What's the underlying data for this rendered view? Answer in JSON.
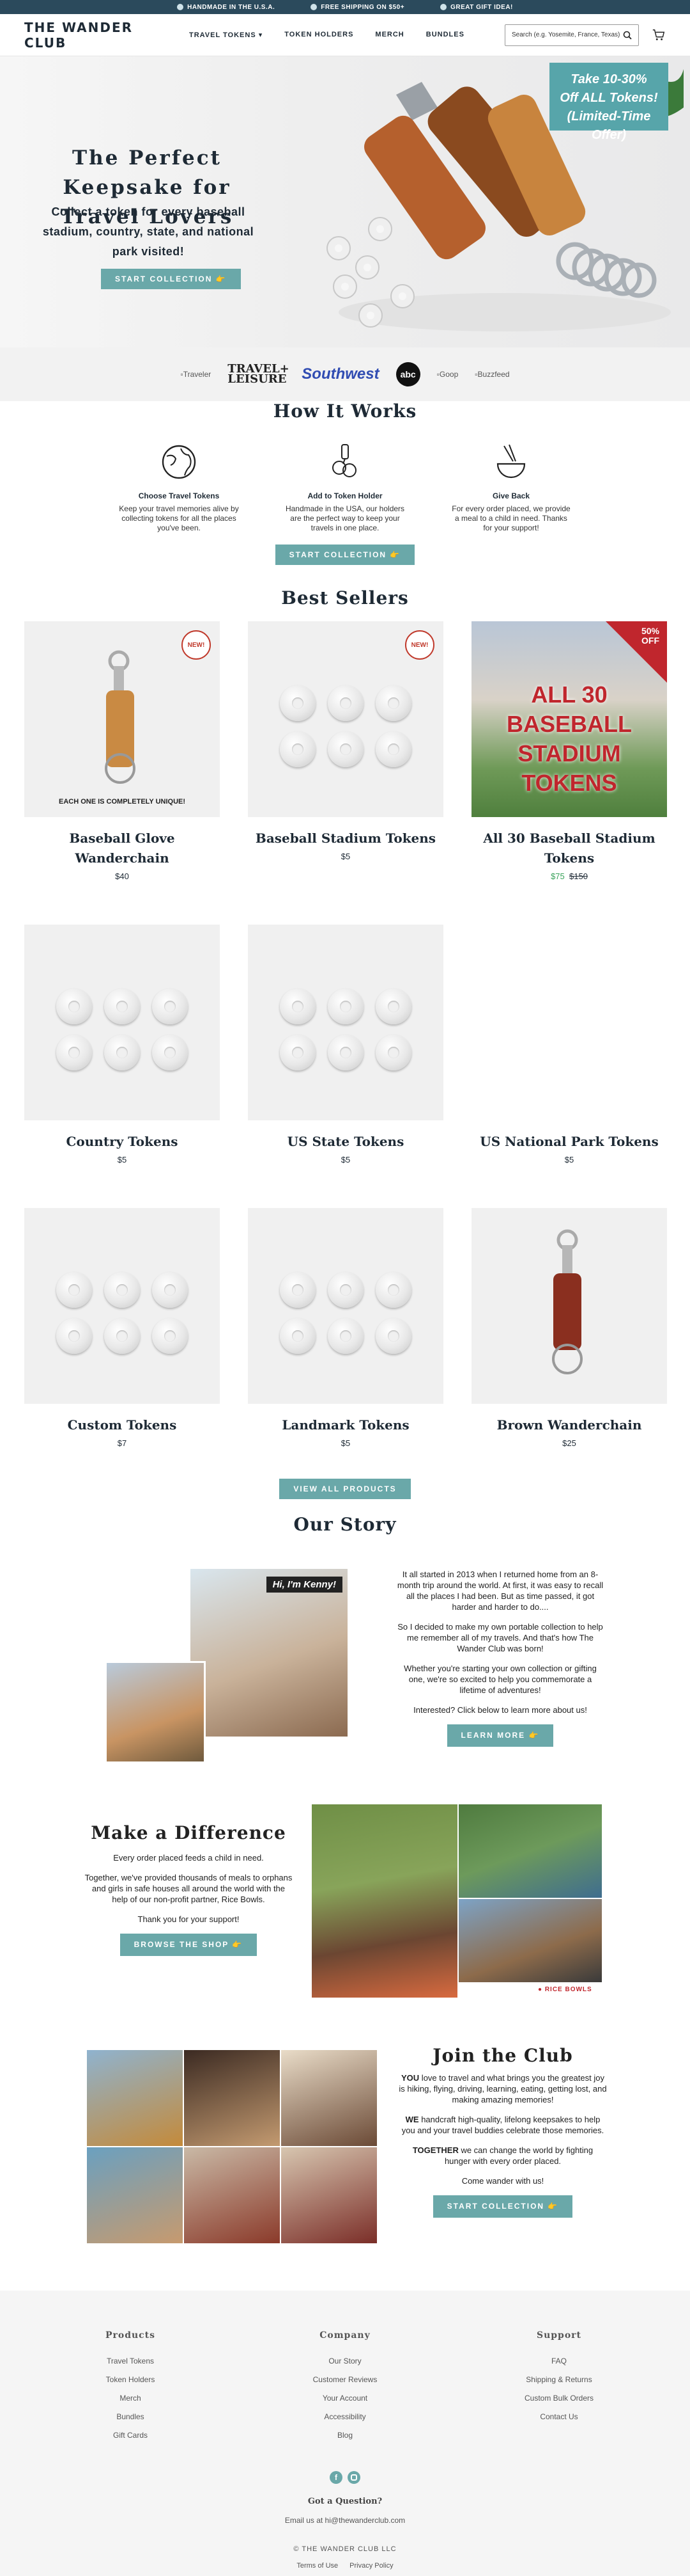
{
  "topbar": {
    "items": [
      "HANDMADE IN THE U.S.A.",
      "FREE SHIPPING ON $50+",
      "GREAT GIFT IDEA!"
    ]
  },
  "header": {
    "logo": "THE WANDER CLUB",
    "nav": [
      "TRAVEL TOKENS",
      "TOKEN HOLDERS",
      "MERCH",
      "BUNDLES"
    ],
    "search_placeholder": "Search (e.g. Yosemite, France, Texas)"
  },
  "hero": {
    "title": "The Perfect Keepsake for Travel Lovers",
    "subtitle": "Collect a token for every baseball stadium, country, state, and national park visited!",
    "cta": "START COLLECTION 👉",
    "badge": [
      "Take 10-30%",
      "Off ALL Tokens!",
      "(Limited-Time Offer)"
    ]
  },
  "press": {
    "logos": [
      "Traveler",
      "TRAVEL+ LEISURE",
      "Southwest",
      "abc",
      "Goop",
      "Buzzfeed"
    ]
  },
  "how": {
    "title": "How It Works",
    "steps": [
      {
        "title": "Choose Travel Tokens",
        "text": "Keep your travel memories alive by collecting tokens for all the places you've been."
      },
      {
        "title": "Add to Token Holder",
        "text": "Handmade in the USA, our holders are the perfect way to keep your travels in one place."
      },
      {
        "title": "Give Back",
        "text": "For every order placed, we provide a meal to a child in need. Thanks for your support!"
      }
    ],
    "cta": "START COLLECTION 👉"
  },
  "best": {
    "title": "Best Sellers",
    "products": [
      {
        "name": "Baseball Glove Wanderchain",
        "price": "$40",
        "caption": "EACH ONE IS COMPLETELY UNIQUE!",
        "badge": "NEW!"
      },
      {
        "name": "Baseball Stadium Tokens",
        "price": "$5",
        "badge": "NEW!"
      },
      {
        "name": "All 30 Baseball Stadium Tokens",
        "sale": "$75",
        "old": "$150",
        "promo": "ALL 30 BASEBALL STADIUM TOKENS",
        "corner": "50% OFF"
      },
      {
        "name": "Country Tokens",
        "price": "$5"
      },
      {
        "name": "US State Tokens",
        "price": "$5"
      },
      {
        "name": "US National Park Tokens",
        "price": "$5"
      },
      {
        "name": "Custom Tokens",
        "price": "$7"
      },
      {
        "name": "Landmark Tokens",
        "price": "$5"
      },
      {
        "name": "Brown Wanderchain",
        "price": "$25"
      }
    ],
    "view_all": "VIEW ALL PRODUCTS"
  },
  "story": {
    "title": "Our Story",
    "bubble": "Hi, I'm Kenny!",
    "paragraphs": [
      "It all started in 2013 when I returned home from an 8-month trip around the world. At first, it was easy to recall all the places I had been. But as time passed, it got harder and harder to do....",
      "So I decided to make my own portable collection to help me remember all of my travels. And that's how The Wander Club was born!",
      "Whether you're starting your own collection or gifting one, we're so excited to help you commemorate a lifetime of adventures!",
      "Interested? Click below to learn more about us!"
    ],
    "cta": "LEARN MORE 👉"
  },
  "difference": {
    "title": "Make a Difference",
    "paragraphs": [
      "Every order placed feeds a child in need.",
      "Together, we've provided thousands of meals to orphans and girls in safe houses all around the world with the help of our non-profit partner, Rice Bowls.",
      "Thank you for your support!"
    ],
    "cta": "BROWSE THE SHOP 👉",
    "partner": "RICE BOWLS"
  },
  "join": {
    "title": "Join the Club",
    "paragraphs": [
      {
        "lead": "YOU",
        "text": " love to travel and what brings you the greatest joy is hiking, flying, driving, learning, eating, getting lost, and making amazing memories!"
      },
      {
        "lead": "WE",
        "text": " handcraft high-quality, lifelong keepsakes to help you and your travel buddies celebrate those memories."
      },
      {
        "lead": "TOGETHER",
        "text": " we can change the world by fighting hunger with every order placed."
      },
      {
        "lead": "",
        "text": "Come wander with us!"
      }
    ],
    "cta": "START COLLECTION 👉"
  },
  "footer": {
    "columns": [
      {
        "title": "Products",
        "links": [
          "Travel Tokens",
          "Token Holders",
          "Merch",
          "Bundles",
          "Gift Cards"
        ]
      },
      {
        "title": "Company",
        "links": [
          "Our Story",
          "Customer Reviews",
          "Your Account",
          "Accessibility",
          "Blog"
        ]
      },
      {
        "title": "Support",
        "links": [
          "FAQ",
          "Shipping & Returns",
          "Custom Bulk Orders",
          "Contact Us"
        ]
      }
    ],
    "question": "Got a Question?",
    "email": "Email us at hi@thewanderclub.com",
    "copyright": "© THE WANDER CLUB LLC",
    "legal": [
      "Terms of Use",
      "Privacy Policy"
    ]
  },
  "colors": {
    "accent": "#6aa8a9",
    "navy": "#2b4a5c",
    "sale": "#3aa35b",
    "promo": "#c0262d"
  }
}
